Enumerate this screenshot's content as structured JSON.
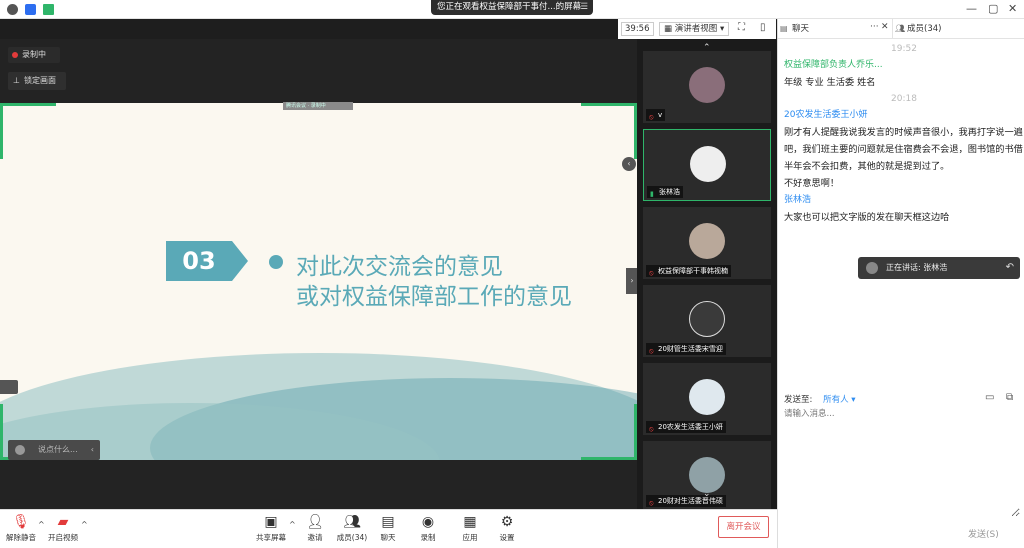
{
  "topbar": {
    "sharing_notice": "您正在观看权益保障部干事付...的屏幕",
    "menu_glyph": "☰",
    "min_glyph": "—",
    "max_glyph": "▢",
    "close_glyph": "✕"
  },
  "meeting_tools": {
    "timer": "39:56",
    "view_mode": "演讲者视图",
    "view_caret": "▾",
    "fullscreen_glyph": "⛶",
    "layout_glyph": "▯"
  },
  "overlay": {
    "recording": "录制中",
    "lock_screen": "锁定画面",
    "pin_glyph": "⊥",
    "say_placeholder": "说点什么...",
    "say_arrow": "‹",
    "mini_label": "腾讯会议 · 录制中"
  },
  "slide": {
    "number": "03",
    "line1": "对此次交流会的意见",
    "line2": "或对权益保障部工作的意见"
  },
  "collapse": {
    "left": "‹",
    "right": "›"
  },
  "tiles": {
    "up": "⌃",
    "down": "⌄",
    "items": [
      {
        "name": "v",
        "active": false
      },
      {
        "name": "张林浩",
        "active": true
      },
      {
        "name": "权益保障部干事韩视楠",
        "active": false
      },
      {
        "name": "20财管生活委宋雪迎",
        "active": false
      },
      {
        "name": "20农发生活委王小妍",
        "active": false
      },
      {
        "name": "20财对生活委晋伟硕",
        "active": false
      }
    ]
  },
  "toolbar": {
    "unmute": "解除静音",
    "start_video": "开启视频",
    "share_screen": "共享屏幕",
    "invite": "邀请",
    "members": "成员(34)",
    "chat": "聊天",
    "record": "录制",
    "apps": "应用",
    "settings": "设置",
    "leave": "离开会议",
    "caret": "^"
  },
  "chat": {
    "tab_chat": "聊天",
    "tab_members": "成员(34)",
    "more_glyph": "···",
    "close_glyph": "✕",
    "messages": [
      {
        "time": "19:52"
      },
      {
        "sender": "权益保障部负责人乔乐...",
        "green": true,
        "text": [
          "年级 专业 生活委 姓名"
        ]
      },
      {
        "time": "20:18"
      },
      {
        "sender": "20农发生活委王小妍",
        "green": false,
        "text": [
          "刚才有人提醒我说我发言的时候声音很小，我再打字说一遍吧，我们班主要的问题就是住宿费会不会退，图书馆的书借半年会不会扣费，其他的就是提到过了。",
          "不好意思啊！"
        ]
      },
      {
        "sender": "张林浩",
        "green": false,
        "text": [
          "大家也可以把文字版的发在聊天框这边哈"
        ]
      }
    ],
    "speaking": "正在讲话: 张林浩",
    "speaking_return": "↶",
    "send_to_label": "发送至:",
    "send_to_value": "所有人 ▾",
    "input_placeholder": "请输入消息...",
    "send_button": "发送(S)",
    "file_glyph": "▭",
    "screenshot_glyph": "⧉"
  }
}
